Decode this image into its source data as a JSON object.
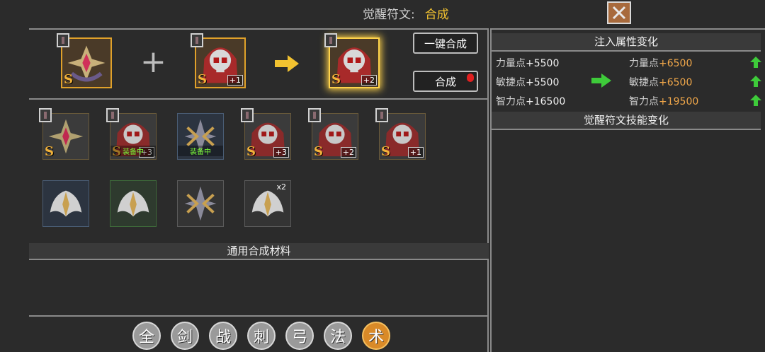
{
  "header": {
    "label": "觉醒符文:",
    "mode": "合成"
  },
  "synthesis": {
    "slot_a": {
      "grade": "S",
      "level": ""
    },
    "slot_b": {
      "grade": "S",
      "level": "+1"
    },
    "result": {
      "grade": "S",
      "level": "+2"
    },
    "plus_symbol": "+",
    "btn_auto": "一键合成",
    "btn_synth": "合成"
  },
  "inventory": {
    "row1": [
      {
        "grade": "S",
        "level": "",
        "equipped": ""
      },
      {
        "grade": "S",
        "level": "+3",
        "equipped": "装备中"
      },
      {
        "grade": "",
        "level": "",
        "equipped": "装备中"
      },
      {
        "grade": "S",
        "level": "+3",
        "equipped": ""
      },
      {
        "grade": "S",
        "level": "+2",
        "equipped": ""
      },
      {
        "grade": "S",
        "level": "+1",
        "equipped": ""
      }
    ],
    "row2": [
      {
        "count": ""
      },
      {
        "count": ""
      },
      {
        "count": ""
      },
      {
        "count": "x2"
      }
    ]
  },
  "materials_header": "通用合成材料",
  "attr_panel": {
    "title": "注入属性变化",
    "stats": [
      {
        "before": "力量点",
        "before_val": "+5500",
        "after": "力量点",
        "after_val": "+6500"
      },
      {
        "before": "敏捷点",
        "before_val": "+5500",
        "after": "敏捷点",
        "after_val": "+6500"
      },
      {
        "before": "智力点",
        "before_val": "+16500",
        "after": "智力点",
        "after_val": "+19500"
      }
    ],
    "skill_title": "觉醒符文技能变化"
  },
  "filters": [
    "全",
    "剑",
    "战",
    "刺",
    "弓",
    "法",
    "术"
  ],
  "colors": {
    "accent": "#f2c230",
    "new_value": "#f2a84a",
    "up_arrow": "#3ecb3a",
    "active_filter": "#d98a28"
  }
}
